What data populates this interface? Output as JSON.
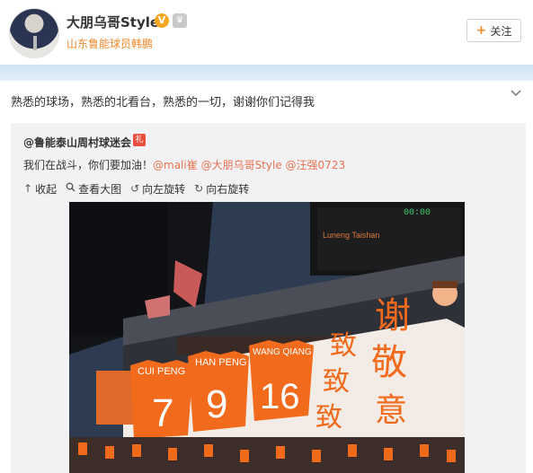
{
  "profile": {
    "name": "大朋乌哥Style",
    "subtitle": "山东鲁能球员韩鹏",
    "verified_icon": "v-badge-icon",
    "member_icon": "crown-icon",
    "follow_label": "关注"
  },
  "post": {
    "text": "熟悉的球场，熟悉的北看台，熟悉的一切，谢谢你们记得我"
  },
  "repost": {
    "author": "@鲁能泰山周村球迷会",
    "text_plain": "我们在战斗，你们要加油！",
    "mentions": [
      "@mali崔",
      "@大朋乌哥Style",
      "@汪强0723"
    ],
    "tools": {
      "collapse": "收起",
      "view_large": "查看大图",
      "rotate_left": "向左旋转",
      "rotate_right": "向右旋转"
    }
  },
  "photo": {
    "scoreboard_text": "Luneng Taishan",
    "scoreboard_time": "00:00",
    "jerseys": [
      {
        "name": "CUI PENG",
        "number": "7"
      },
      {
        "name": "HAN PENG",
        "number": "9"
      },
      {
        "name": "WANG QIANG",
        "number": "16"
      }
    ],
    "banner_chars_left": [
      "致",
      "致",
      "致"
    ],
    "banner_chars_right": [
      "谢",
      "敬",
      "意"
    ],
    "colors": {
      "orange": "#f26a1b",
      "banner": "#f3ece6",
      "sky": "#2d3b4f"
    }
  }
}
